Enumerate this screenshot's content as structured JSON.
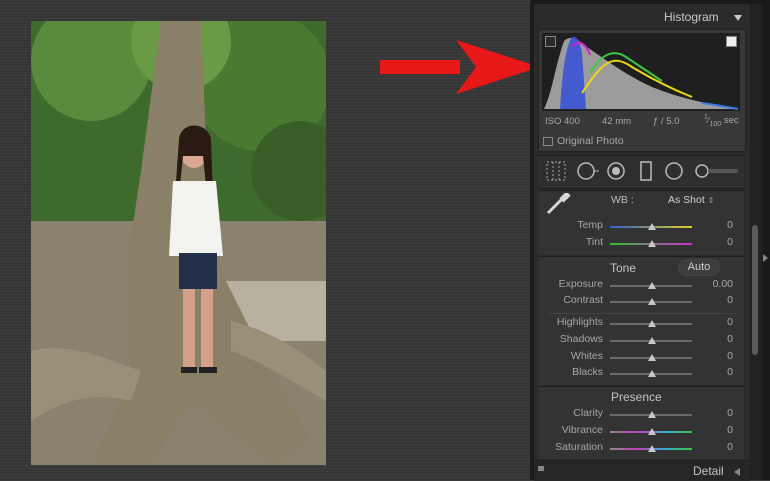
{
  "histogram": {
    "title": "Histogram",
    "iso": "ISO 400",
    "focal": "42 mm",
    "aperture": "ƒ / 5.0",
    "shutter_num": "1",
    "shutter_den": "100",
    "shutter_unit": "sec",
    "original_photo": "Original Photo"
  },
  "wb": {
    "label": "WB :",
    "value": "As Shot"
  },
  "basic": {
    "temp": {
      "label": "Temp",
      "value": "0"
    },
    "tint": {
      "label": "Tint",
      "value": "0"
    }
  },
  "tone": {
    "title": "Tone",
    "auto": "Auto",
    "exposure": {
      "label": "Exposure",
      "value": "0.00"
    },
    "contrast": {
      "label": "Contrast",
      "value": "0"
    },
    "highlights": {
      "label": "Highlights",
      "value": "0"
    },
    "shadows": {
      "label": "Shadows",
      "value": "0"
    },
    "whites": {
      "label": "Whites",
      "value": "0"
    },
    "blacks": {
      "label": "Blacks",
      "value": "0"
    }
  },
  "presence": {
    "title": "Presence",
    "clarity": {
      "label": "Clarity",
      "value": "0"
    },
    "vibrance": {
      "label": "Vibrance",
      "value": "0"
    },
    "saturation": {
      "label": "Saturation",
      "value": "0"
    }
  },
  "footer": {
    "detail": "Detail"
  },
  "colors": {
    "arrow": "#e81818",
    "panel": "#2b2b2b"
  }
}
